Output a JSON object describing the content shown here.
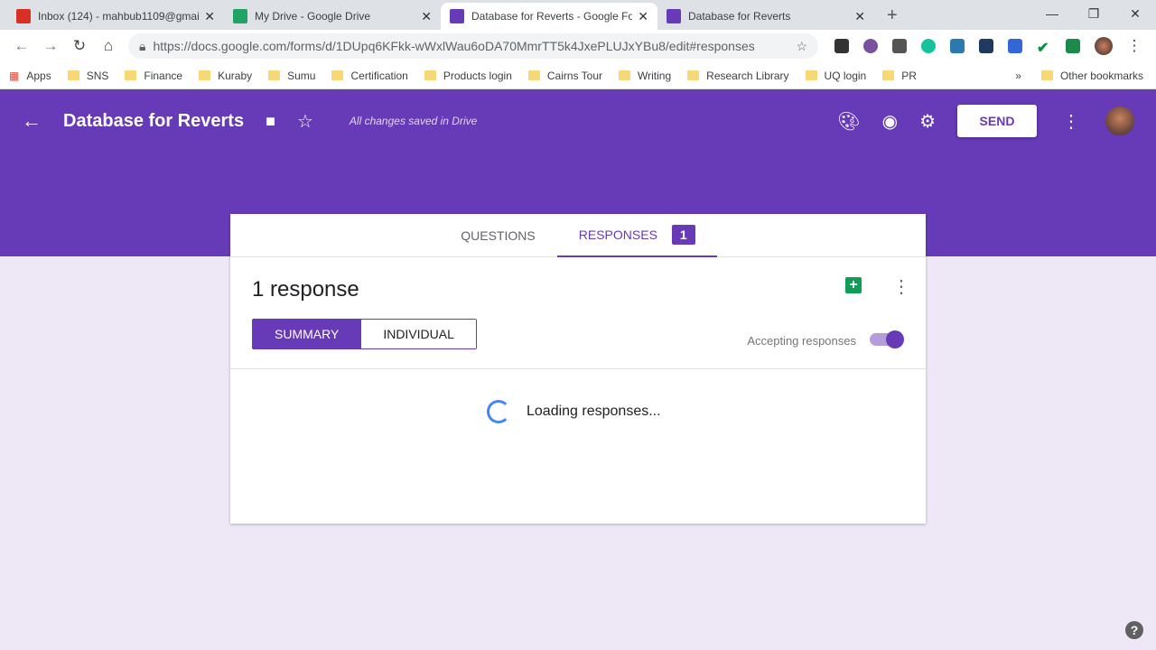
{
  "browser": {
    "tabs": [
      {
        "title": "Inbox (124) - mahbub1109@gmail.com",
        "icon": "gmail-icon",
        "color": "#d93025"
      },
      {
        "title": "My Drive - Google Drive",
        "icon": "drive-icon",
        "color": "#1fa463"
      },
      {
        "title": "Database for Reverts - Google Forms",
        "icon": "forms-icon",
        "color": "#673ab7"
      },
      {
        "title": "Database for Reverts",
        "icon": "forms-icon",
        "color": "#673ab7"
      }
    ],
    "url": "https://docs.google.com/forms/d/1DUpq6KFkk-wWxlWau6oDA70MmrTT5k4JxePLUJxYBu8/edit#responses",
    "bookmarks": [
      "Apps",
      "SNS",
      "Finance",
      "Kuraby",
      "Sumu",
      "Certification",
      "Products login",
      "Cairns Tour",
      "Writing",
      "Research Library",
      "UQ login",
      "PR"
    ],
    "other_bookmarks": "Other bookmarks",
    "overflow": "»"
  },
  "header": {
    "title": "Database for Reverts",
    "saved_status": "All changes saved in Drive",
    "send_label": "SEND",
    "accent": "#673ab7"
  },
  "form_tabs": {
    "questions": "QUESTIONS",
    "responses": "RESPONSES",
    "responses_badge": "1"
  },
  "responses": {
    "count_label": "1 response",
    "summary": "SUMMARY",
    "individual": "INDIVIDUAL",
    "accepting_label": "Accepting responses",
    "accepting": true,
    "loading": "Loading responses..."
  },
  "help": "?"
}
